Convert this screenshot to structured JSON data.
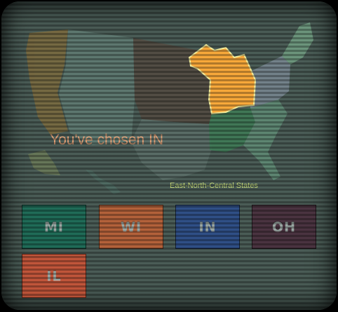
{
  "status": {
    "chosen_text": "You've chosen IN",
    "region_label": "East-North-Central States"
  },
  "map": {
    "highlighted_region": "East-North-Central States",
    "highlight_color": "#f7a83a"
  },
  "buttons": [
    {
      "label": "MI",
      "color": "#1f6b57",
      "selected": false
    },
    {
      "label": "WI",
      "color": "#b3613a",
      "selected": false
    },
    {
      "label": "IN",
      "color": "#2f4f86",
      "selected": true
    },
    {
      "label": "OH",
      "color": "#4a3340",
      "selected": false
    },
    {
      "label": "IL",
      "color": "#c0553a",
      "selected": false
    }
  ]
}
